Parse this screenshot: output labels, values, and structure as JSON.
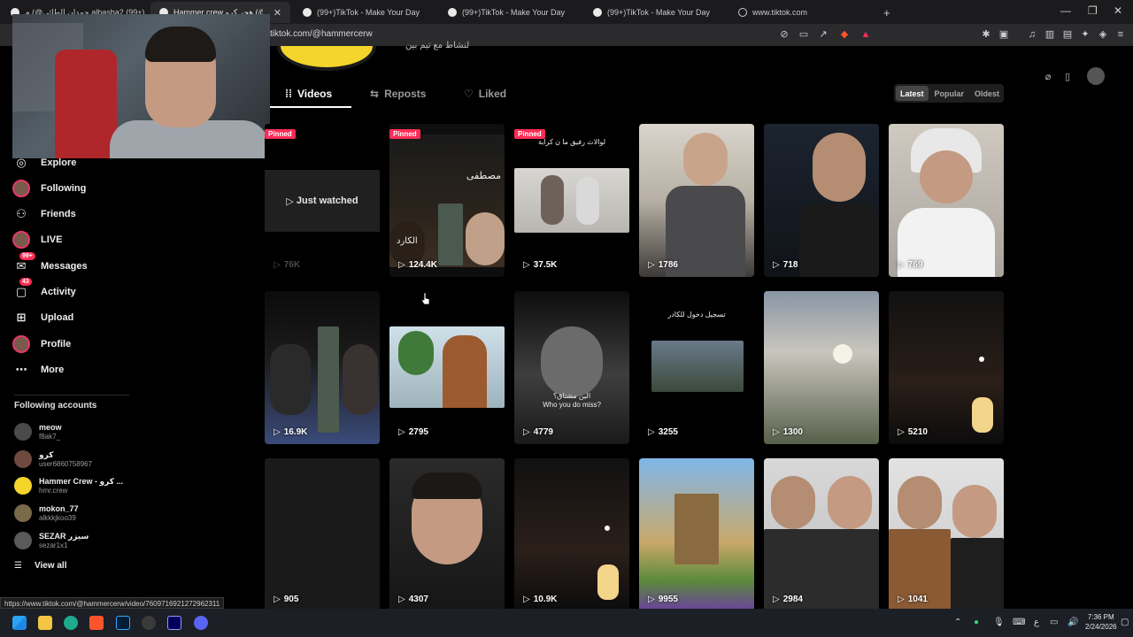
{
  "browser": {
    "tabs": [
      {
        "title": "حمدان الطائي@) م.albasha2 (99+)"
      },
      {
        "title": "Hammer crew هجر كرو (@hamm...",
        "active": true
      },
      {
        "title": "(99+)TikTok - Make Your Day"
      },
      {
        "title": "(99+)TikTok - Make Your Day"
      },
      {
        "title": "(99+)TikTok - Make Your Day"
      },
      {
        "title": "www.tiktok.com"
      }
    ],
    "new_tab": "+",
    "url": "tiktok.com/@hammercerw",
    "status_url": "https://www.tiktok.com/@hammercerw/video/7609716921272962311"
  },
  "profile": {
    "bio": "لنشاط مع تيم بين",
    "tabs": {
      "videos": "Videos",
      "reposts": "Reposts",
      "liked": "Liked"
    },
    "sort": {
      "latest": "Latest",
      "popular": "Popular",
      "oldest": "Oldest"
    }
  },
  "sidebar": {
    "nav": [
      {
        "label": "Explore",
        "icon": "compass-icon"
      },
      {
        "label": "Following",
        "icon": "avatar"
      },
      {
        "label": "Friends",
        "icon": "friends-icon"
      },
      {
        "label": "LIVE",
        "icon": "avatar"
      },
      {
        "label": "Messages",
        "icon": "messages-icon",
        "badge": "99+"
      },
      {
        "label": "Activity",
        "icon": "activity-icon",
        "badge": "43"
      },
      {
        "label": "Upload",
        "icon": "upload-icon"
      },
      {
        "label": "Profile",
        "icon": "avatar"
      },
      {
        "label": "More",
        "icon": "more-icon"
      }
    ],
    "following_heading": "Following accounts",
    "accounts": [
      {
        "name": "meow",
        "handle": "f8ak7_"
      },
      {
        "name": "كرو",
        "handle": "user6860758967"
      },
      {
        "name": "Hammer Crew - كرو ...",
        "handle": "hmr.crew"
      },
      {
        "name": "mokon_77",
        "handle": "alkkkjkoo39"
      },
      {
        "name": "SEZAR سيزر",
        "handle": "sezar1x1"
      }
    ],
    "view_all": "View all"
  },
  "videos": [
    {
      "views": "76K",
      "pinned": "Pinned",
      "overlay": "Just watched"
    },
    {
      "views": "124.4K",
      "pinned": "Pinned",
      "caption": "مصطفى",
      "caption2": "الكارد"
    },
    {
      "views": "37.5K",
      "pinned": "Pinned",
      "caption": "لوالاث رفيق ما ن كرابة"
    },
    {
      "views": "1786"
    },
    {
      "views": "718"
    },
    {
      "views": "769"
    },
    {
      "views": "16.9K"
    },
    {
      "views": "2795"
    },
    {
      "views": "4779",
      "caption": "الين مشتاق؟",
      "caption2": "Who you do miss?"
    },
    {
      "views": "3255",
      "caption": "تسجيل دخول للكادر"
    },
    {
      "views": "1300"
    },
    {
      "views": "5210"
    },
    {
      "views": "905"
    },
    {
      "views": "4307"
    },
    {
      "views": "10.9K"
    },
    {
      "views": "9955"
    },
    {
      "views": "2984"
    },
    {
      "views": "1041"
    }
  ],
  "taskbar": {
    "time": "7:36 PM",
    "date": "2/24/2026"
  },
  "colors": {
    "accent": "#fe2c55",
    "background": "#000000"
  }
}
